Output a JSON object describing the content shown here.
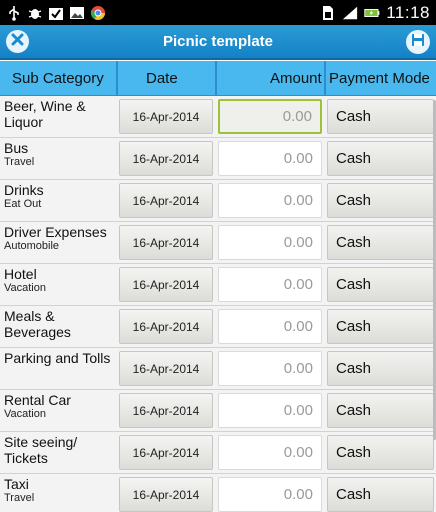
{
  "status_bar": {
    "time": "11:18",
    "left_icons": [
      "usb-icon",
      "bug-icon",
      "check-icon",
      "photo-icon",
      "chrome-icon"
    ],
    "right_icons": [
      "sim-icon",
      "signal-icon",
      "battery-charging-icon"
    ]
  },
  "toolbar": {
    "title": "Picnic template"
  },
  "table": {
    "headers": {
      "sub_category": "Sub Category",
      "date": "Date",
      "amount": "Amount",
      "payment_mode": "Payment Mode"
    },
    "rows": [
      {
        "name": "Beer, Wine & Liquor",
        "sub": "",
        "date": "16-Apr-2014",
        "amount": "0.00",
        "payment": "Cash",
        "focused": true
      },
      {
        "name": "Bus",
        "sub": "Travel",
        "date": "16-Apr-2014",
        "amount": "0.00",
        "payment": "Cash"
      },
      {
        "name": "Drinks",
        "sub": "Eat Out",
        "date": "16-Apr-2014",
        "amount": "0.00",
        "payment": "Cash"
      },
      {
        "name": "Driver Expenses",
        "sub": "Automobile",
        "date": "16-Apr-2014",
        "amount": "0.00",
        "payment": "Cash"
      },
      {
        "name": "Hotel",
        "sub": "Vacation",
        "date": "16-Apr-2014",
        "amount": "0.00",
        "payment": "Cash"
      },
      {
        "name": "Meals & Beverages",
        "sub": "",
        "date": "16-Apr-2014",
        "amount": "0.00",
        "payment": "Cash"
      },
      {
        "name": "Parking and Tolls",
        "sub": "",
        "date": "16-Apr-2014",
        "amount": "0.00",
        "payment": "Cash"
      },
      {
        "name": "Rental Car",
        "sub": "Vacation",
        "date": "16-Apr-2014",
        "amount": "0.00",
        "payment": "Cash"
      },
      {
        "name": "Site seeing/ Tickets",
        "sub": "",
        "date": "16-Apr-2014",
        "amount": "0.00",
        "payment": "Cash"
      },
      {
        "name": "Taxi",
        "sub": "Travel",
        "date": "16-Apr-2014",
        "amount": "0.00",
        "payment": "Cash"
      }
    ]
  },
  "colors": {
    "title_bar": "#1a8bcf",
    "header": "#48b8ef",
    "focus_border": "#9cc23a"
  }
}
